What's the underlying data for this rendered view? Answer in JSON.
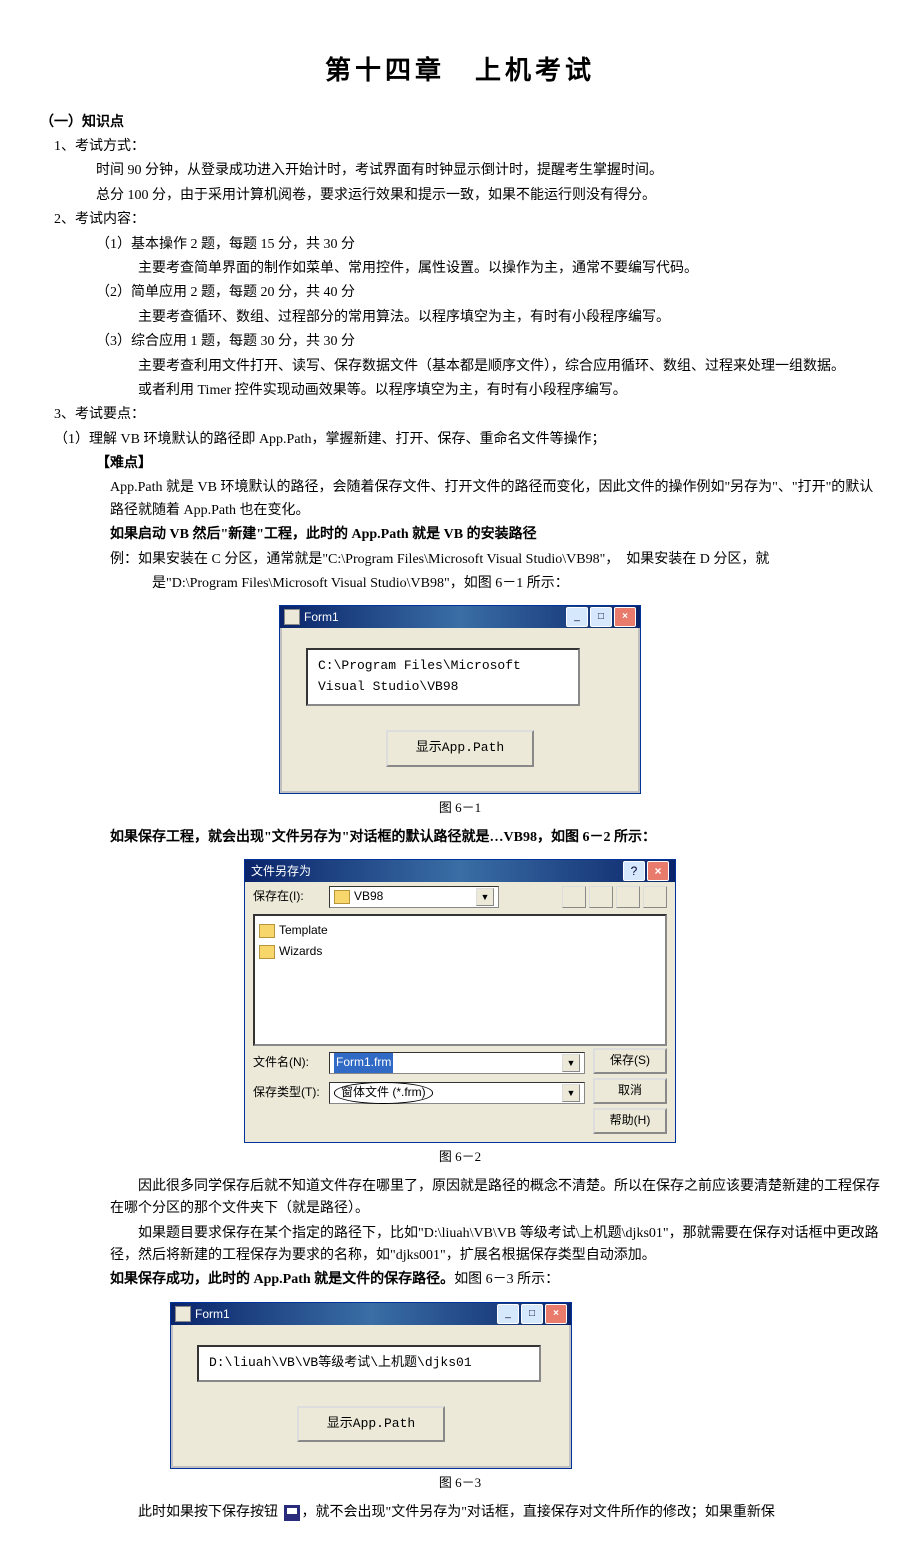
{
  "title": "第十四章　上机考试",
  "section1_h": "（一）知识点",
  "p1_h": "1、考试方式：",
  "p1_l1": "时间 90 分钟，从登录成功进入开始计时，考试界面有时钟显示倒计时，提醒考生掌握时间。",
  "p1_l2": "总分 100 分，由于采用计算机阅卷，要求运行效果和提示一致，如果不能运行则没有得分。",
  "p2_h": "2、考试内容：",
  "p2_i1": "（1）基本操作 2 题，每题 15 分，共 30 分",
  "p2_i1d": "主要考查简单界面的制作如菜单、常用控件，属性设置。以操作为主，通常不要编写代码。",
  "p2_i2": "（2）简单应用 2 题，每题 20 分，共 40 分",
  "p2_i2d": "主要考查循环、数组、过程部分的常用算法。以程序填空为主，有时有小段程序编写。",
  "p2_i3": "（3）综合应用 1 题，每题 30 分，共 30 分",
  "p2_i3d1": "主要考查利用文件打开、读写、保存数据文件（基本都是顺序文件），综合应用循环、数组、过程来处理一组数据。",
  "p2_i3d2": "或者利用 Timer 控件实现动画效果等。以程序填空为主，有时有小段程序编写。",
  "p3_h": "3、考试要点：",
  "p3_l1": "（1）理解 VB 环境默认的路径即 App.Path，掌握新建、打开、保存、重命名文件等操作；",
  "diff_h": "【难点】",
  "diff_p1": "App.Path 就是 VB 环境默认的路径，会随着保存文件、打开文件的路径而变化，因此文件的操作例如\"另存为\"、\"打开\"的默认路径就随着 App.Path 也在变化。",
  "bold1": "如果启动 VB 然后\"新建\"工程，此时的 App.Path 就是 VB 的安装路径",
  "ex1a": "例：如果安装在 C 分区，通常就是\"C:\\Program Files\\Microsoft Visual Studio\\VB98\"，　如果安装在 D 分区，就",
  "ex1b": "是\"D:\\Program Files\\Microsoft Visual Studio\\VB98\"，如图 6－1 所示：",
  "form1": {
    "title": "Form1",
    "text_l1": "C:\\Program Files\\Microsoft",
    "text_l2": "Visual Studio\\VB98",
    "btn": "显示App.Path"
  },
  "cap1": "图 6－1",
  "afterfig1": "如果保存工程，就会出现\"文件另存为\"对话框的默认路径就是…VB98，如图 6－2 所示：",
  "saveas": {
    "title": "文件另存为",
    "save_in_label": "保存在(I):",
    "folder": "VB98",
    "items": [
      "Template",
      "Wizards"
    ],
    "fn_label": "文件名(N):",
    "fn_value": "Form1.frm",
    "type_label": "保存类型(T):",
    "type_value": "窗体文件 (*.frm)",
    "btn_save": "保存(S)",
    "btn_cancel": "取消",
    "btn_help": "帮助(H)"
  },
  "cap2": "图 6－2",
  "para2": "因此很多同学保存后就不知道文件存在哪里了，原因就是路径的概念不清楚。所以在保存之前应该要清楚新建的工程保存在哪个分区的那个文件夹下（就是路径）。",
  "para3": "如果题目要求保存在某个指定的路径下，比如\"D:\\liuah\\VB\\VB 等级考试\\上机题\\djks01\"，那就需要在保存对话框中更改路径，然后将新建的工程保存为要求的名称，如\"djks001\"，扩展名根据保存类型自动添加。",
  "bold2a": "如果保存成功，此时的 App.Path 就是文件的保存路径。",
  "bold2b": "如图 6－3 所示：",
  "form3": {
    "title": "Form1",
    "text": "D:\\liuah\\VB\\VB等级考试\\上机题\\djks01",
    "btn": "显示App.Path"
  },
  "cap3": "图 6－3",
  "last_a": "此时如果按下保存按钮 ",
  "last_b": "，就不会出现\"文件另存为\"对话框，直接保存对文件所作的修改；如果重新保"
}
